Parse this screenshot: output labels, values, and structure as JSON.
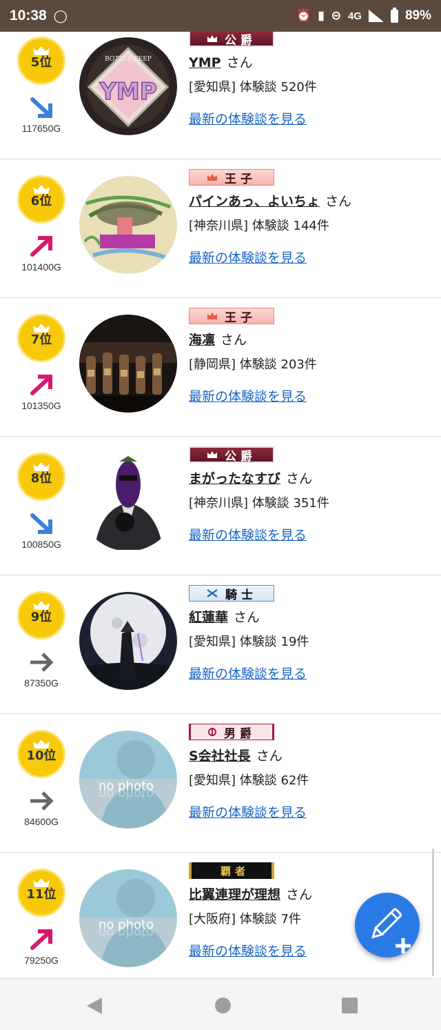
{
  "status_bar": {
    "time": "10:38",
    "network": "4G",
    "battery": "89%"
  },
  "ranking": [
    {
      "rank": "5位",
      "trend": "down",
      "points": "117650G",
      "title": "公爵",
      "title_style": "marquis",
      "name": "YMP",
      "honorific": "さん",
      "prefecture": "[愛知県]",
      "reviews": "体験談 520件",
      "link": "最新の体験談を見る",
      "avatar": "bottle-keep"
    },
    {
      "rank": "6位",
      "trend": "up",
      "points": "101400G",
      "title": "王子",
      "title_style": "prince",
      "name": "パインあっ、よいちょ",
      "honorific": "さん",
      "prefecture": "[神奈川県]",
      "reviews": "体験談 144件",
      "link": "最新の体験談を見る",
      "avatar": "drawing"
    },
    {
      "rank": "7位",
      "trend": "up",
      "points": "101350G",
      "title": "王子",
      "title_style": "prince",
      "name": "海凛",
      "honorific": "さん",
      "prefecture": "[静岡県]",
      "reviews": "体験談 203件",
      "link": "最新の体験談を見る",
      "avatar": "bottles"
    },
    {
      "rank": "8位",
      "trend": "down",
      "points": "100850G",
      "title": "公爵",
      "title_style": "marquis",
      "name": "まがったなすび",
      "honorific": "さん",
      "prefecture": "[神奈川県]",
      "reviews": "体験談 351件",
      "link": "最新の体験談を見る",
      "avatar": "eggplant"
    },
    {
      "rank": "9位",
      "trend": "flat",
      "points": "87350G",
      "title": "騎士",
      "title_style": "knight",
      "name": "紅蓮華",
      "honorific": "さん",
      "prefecture": "[愛知県]",
      "reviews": "体験談 19件",
      "link": "最新の体験談を見る",
      "avatar": "moon"
    },
    {
      "rank": "10位",
      "trend": "flat",
      "points": "84600G",
      "title": "男爵",
      "title_style": "baron",
      "name": "S会社社長",
      "honorific": "さん",
      "prefecture": "[愛知県]",
      "reviews": "体験談 62件",
      "link": "最新の体験談を見る",
      "avatar": "no-photo"
    },
    {
      "rank": "11位",
      "trend": "up",
      "points": "79250G",
      "title": "覇者",
      "title_style": "haja",
      "name": "比翼連理が理想",
      "honorific": "さん",
      "prefecture": "[大阪府]",
      "reviews": "体験談 7件",
      "link": "最新の体験談を見る",
      "avatar": "no-photo"
    }
  ],
  "no_photo_text": "no photo",
  "fab": {
    "icon": "pencil-plus-icon"
  },
  "colors": {
    "badge": "#f7c90a",
    "up": "#d6196e",
    "down": "#3b82d6",
    "flat": "#666666",
    "link": "#1a64c8",
    "fab": "#2b7be6"
  }
}
